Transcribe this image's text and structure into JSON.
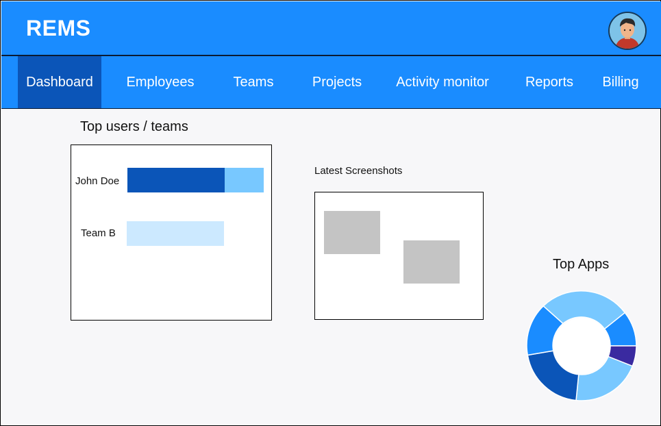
{
  "app": {
    "title": "REMS"
  },
  "header": {
    "avatar_icon": "user-avatar-icon"
  },
  "nav": {
    "items": [
      {
        "label": "Dashboard",
        "active": true
      },
      {
        "label": "Employees",
        "active": false
      },
      {
        "label": "Teams",
        "active": false
      },
      {
        "label": "Projects",
        "active": false
      },
      {
        "label": "Activity monitor",
        "active": false
      },
      {
        "label": "Reports",
        "active": false
      },
      {
        "label": "Billing",
        "active": false
      }
    ]
  },
  "top_users": {
    "title": "Top users / teams",
    "rows": [
      {
        "label": "John Doe"
      },
      {
        "label": "Team B"
      }
    ]
  },
  "screenshots": {
    "title": "Latest Screenshots"
  },
  "top_apps": {
    "title": "Top Apps"
  },
  "colors": {
    "primary": "#1a8cff",
    "nav_active": "#0b55b8",
    "bar_dark": "#0b55b8",
    "bar_light": "#78c8ff",
    "bar_pale": "#cce9ff",
    "donut_purple": "#3a2aa0"
  }
}
